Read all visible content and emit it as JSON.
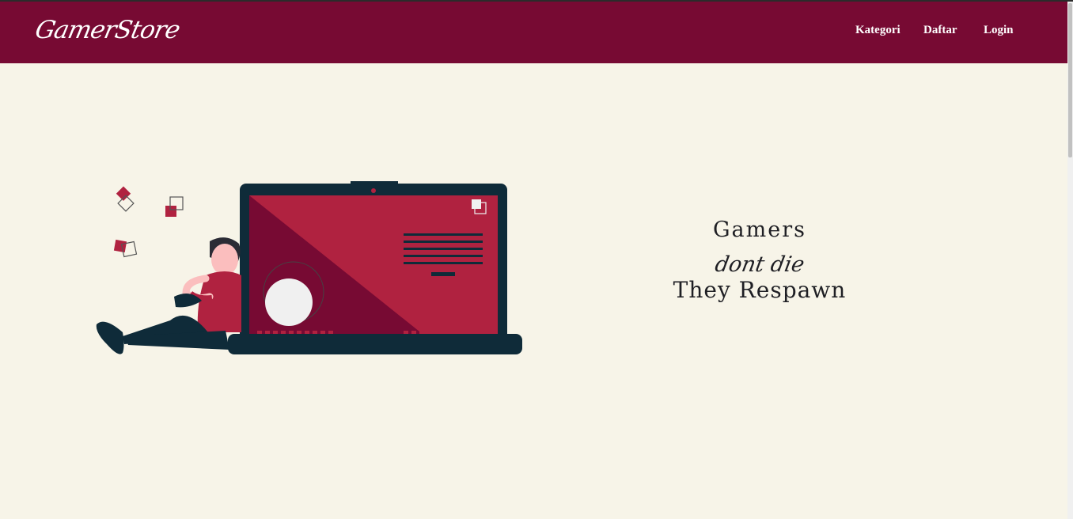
{
  "brand": {
    "name": "GamerStore"
  },
  "nav": {
    "items": [
      {
        "label": "Kategori"
      },
      {
        "label": "Daftar"
      },
      {
        "label": "Login"
      }
    ]
  },
  "hero": {
    "line1": "Gamers",
    "line2": "dont die",
    "line3": "They Respawn"
  },
  "colors": {
    "navbar": "#770a33",
    "background": "#f7f4e8",
    "accent": "#b02240",
    "dark": "#0f2b39"
  }
}
